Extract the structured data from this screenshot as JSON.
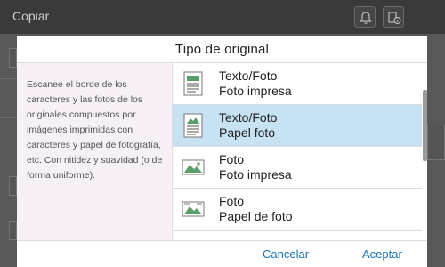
{
  "app": {
    "title": "Copiar"
  },
  "header_icons": [
    "bell-icon",
    "status-info-icon"
  ],
  "dialog": {
    "title": "Tipo de original",
    "description": "Escanee el borde de los caracteres y las fotos de los originales compuestos por imágenes imprimidas con caracteres y papel de fotografía, etc. Con nitidez y suavidad (o de forma uniforme).",
    "items": [
      {
        "line1": "Texto/Foto",
        "line2": "Foto impresa",
        "icon": "text-photo-document-icon",
        "selected": false
      },
      {
        "line1": "Texto/Foto",
        "line2": "Papel foto",
        "icon": "text-photo-paper-icon",
        "selected": true
      },
      {
        "line1": "Foto",
        "line2": "Foto impresa",
        "icon": "photo-printed-icon",
        "selected": false
      },
      {
        "line1": "Foto",
        "line2": "Papel de foto",
        "icon": "photo-paper-icon",
        "selected": false
      }
    ],
    "cancel_label": "Cancelar",
    "accept_label": "Aceptar"
  },
  "colors": {
    "accent": "#1877b8",
    "selected_bg": "#c6e2f3",
    "desc_bg": "#f7f0f7"
  }
}
